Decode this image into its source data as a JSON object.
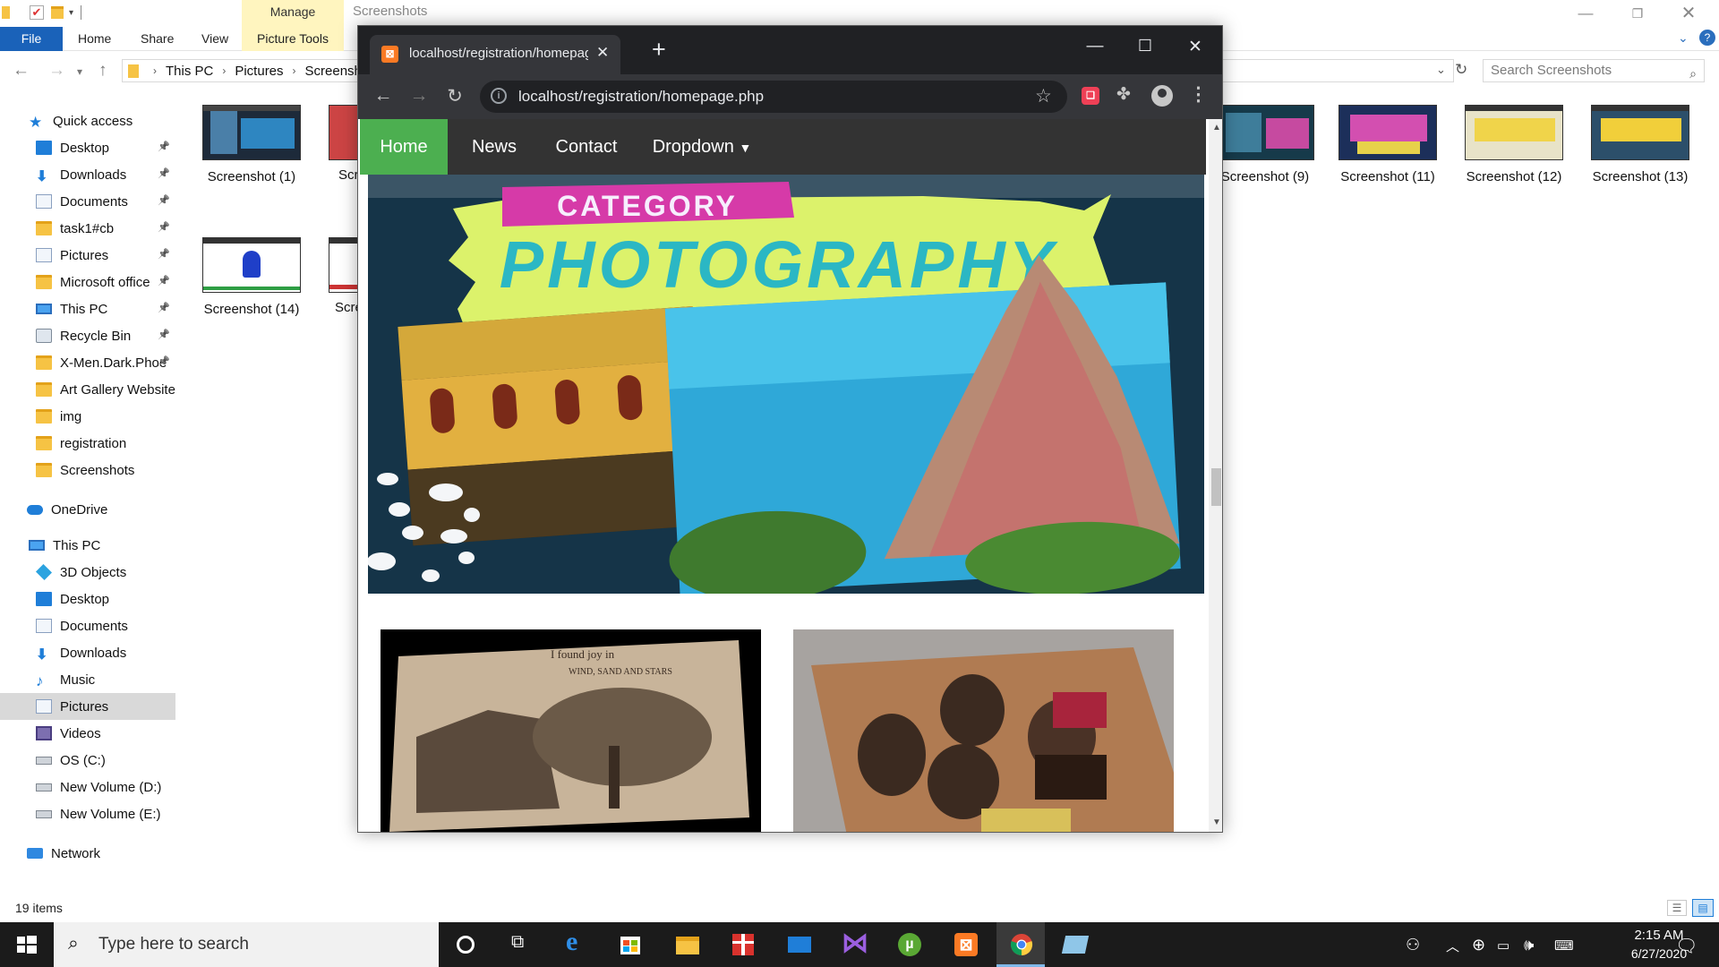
{
  "explorer": {
    "window_title": "Screenshots",
    "contextual_tab": "Manage",
    "ribbon_tabs": [
      "File",
      "Home",
      "Share",
      "View",
      "Picture Tools"
    ],
    "breadcrumb": [
      "This PC",
      "Pictures",
      "Screensho"
    ],
    "search_placeholder": "Search Screenshots",
    "nav_items": [
      {
        "label": "Quick access",
        "icon": "star-icon",
        "pinned": false
      },
      {
        "label": "Desktop",
        "icon": "desktop-folder-icon",
        "pinned": true
      },
      {
        "label": "Downloads",
        "icon": "download-arrow-icon",
        "pinned": true
      },
      {
        "label": "Documents",
        "icon": "document-icon",
        "pinned": true
      },
      {
        "label": "task1#cb",
        "icon": "folder-icon",
        "pinned": true
      },
      {
        "label": "Pictures",
        "icon": "pictures-folder-icon",
        "pinned": true
      },
      {
        "label": "Microsoft office",
        "icon": "folder-icon",
        "pinned": true
      },
      {
        "label": "This PC",
        "icon": "computer-icon",
        "pinned": true
      },
      {
        "label": "Recycle Bin",
        "icon": "recycle-bin-icon",
        "pinned": true
      },
      {
        "label": "X-Men.Dark.Phoe",
        "icon": "folder-icon",
        "pinned": true
      },
      {
        "label": "Art Gallery Website",
        "icon": "folder-icon",
        "pinned": false
      },
      {
        "label": "img",
        "icon": "folder-icon",
        "pinned": false
      },
      {
        "label": "registration",
        "icon": "folder-icon",
        "pinned": false
      },
      {
        "label": "Screenshots",
        "icon": "folder-icon",
        "pinned": false
      },
      {
        "label": "OneDrive",
        "icon": "onedrive-cloud-icon",
        "pinned": false
      },
      {
        "label": "This PC",
        "icon": "computer-icon",
        "pinned": false
      },
      {
        "label": "3D Objects",
        "icon": "3d-objects-icon",
        "pinned": false
      },
      {
        "label": "Desktop",
        "icon": "desktop-folder-icon",
        "pinned": false
      },
      {
        "label": "Documents",
        "icon": "document-icon",
        "pinned": false
      },
      {
        "label": "Downloads",
        "icon": "download-arrow-icon",
        "pinned": false
      },
      {
        "label": "Music",
        "icon": "music-note-icon",
        "pinned": false
      },
      {
        "label": "Pictures",
        "icon": "pictures-folder-icon",
        "pinned": false,
        "selected": true
      },
      {
        "label": "Videos",
        "icon": "videos-folder-icon",
        "pinned": false
      },
      {
        "label": "OS (C:)",
        "icon": "drive-icon",
        "pinned": false
      },
      {
        "label": "New Volume (D:)",
        "icon": "drive-icon",
        "pinned": false
      },
      {
        "label": "New Volume (E:)",
        "icon": "drive-icon",
        "pinned": false
      },
      {
        "label": "Network",
        "icon": "network-icon",
        "pinned": false
      }
    ],
    "thumbnails": [
      {
        "label": "Screenshot (1)"
      },
      {
        "label": "Screenshot (9)"
      },
      {
        "label": "Screenshot (11)"
      },
      {
        "label": "Screenshot (12)"
      },
      {
        "label": "Screenshot (13)"
      },
      {
        "label": "Screenshot (14)"
      }
    ],
    "partial_labels": [
      "Scr",
      "Scre"
    ],
    "status_text": "19 items"
  },
  "chrome": {
    "tab_title": "localhost/registration/homepage",
    "url": "localhost/registration/homepage.php",
    "site_nav": [
      "Home",
      "News",
      "Contact",
      "Dropdown"
    ],
    "banner_tag": "CATEGORY",
    "banner_title": "PHOTOGRAPHY",
    "card_text": [
      "I found joy in",
      "WIND, SAND AND STARS"
    ]
  },
  "taskbar": {
    "search_placeholder": "Type here to search",
    "time": "2:15 AM",
    "date": "6/27/2020"
  },
  "colors": {
    "explorer_file_tab": "#1a62b9",
    "picture_tools_tab": "#fff5bf",
    "site_nav_bg": "#333333",
    "site_nav_active": "#4caf50",
    "banner_tag": "#d63aa8",
    "banner_title_bg": "#dcf26b",
    "banner_title_text": "#2bb7c4"
  }
}
